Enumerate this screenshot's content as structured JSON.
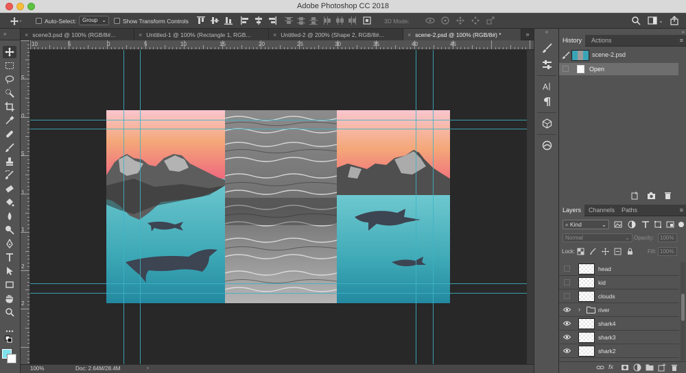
{
  "window": {
    "title": "Adobe Photoshop CC 2018"
  },
  "options_bar": {
    "auto_select_label": "Auto-Select:",
    "auto_select_value": "Group",
    "show_transform_label": "Show Transform Controls",
    "mode_3d_label": "3D Mode:"
  },
  "tabs": [
    {
      "label": "scene3.psd @ 100% (RGB/8#...",
      "active": false
    },
    {
      "label": "Untitled-1 @ 100% (Rectangle 1, RGB...",
      "active": false
    },
    {
      "label": "Untitled-2 @ 200% (Shape 2, RGB/8#...",
      "active": false
    },
    {
      "label": "scene-2.psd @ 100% (RGB/8#) *",
      "active": true
    }
  ],
  "ruler": {
    "h_labels": [
      "10",
      "5",
      "0",
      "5",
      "10",
      "15",
      "20",
      "25",
      "30",
      "35",
      "40",
      "45"
    ],
    "v_labels": [
      "5",
      "0",
      "5",
      "1",
      "1",
      "2",
      "2"
    ]
  },
  "status": {
    "zoom": "100%",
    "doc_info": "Doc: 2.64M/28.4M",
    "arrow": "›"
  },
  "history_panel": {
    "tabs": [
      "History",
      "Actions"
    ],
    "snapshot_label": "scene-2.psd",
    "items": [
      "Open"
    ]
  },
  "layers_panel": {
    "tabs": [
      "Layers",
      "Channels",
      "Paths"
    ],
    "kind_filter": "Kind",
    "blend_mode": "Normal",
    "opacity_label": "Opacity:",
    "opacity_value": "100%",
    "lock_label": "Lock:",
    "fill_label": "Fill:",
    "fill_value": "100%",
    "layers": [
      {
        "name": "head",
        "visible": false,
        "type": "pixel"
      },
      {
        "name": "kid",
        "visible": false,
        "type": "pixel"
      },
      {
        "name": "clouds",
        "visible": false,
        "type": "pixel"
      },
      {
        "name": "river",
        "visible": true,
        "type": "group"
      },
      {
        "name": "shark4",
        "visible": true,
        "type": "pixel"
      },
      {
        "name": "shark3",
        "visible": true,
        "type": "pixel"
      },
      {
        "name": "shark2",
        "visible": true,
        "type": "pixel"
      }
    ]
  },
  "colors": {
    "guide": "#3eb3c4",
    "foreground": "#ffffff",
    "background": "#7fe3ee",
    "sky_top": "#f8c2c5",
    "sky_mid": "#f2906e",
    "water": "#4fb3bf"
  }
}
